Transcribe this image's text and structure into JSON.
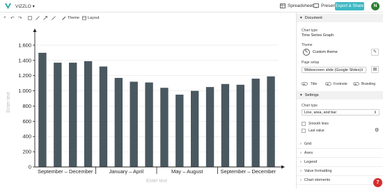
{
  "app": {
    "name": "VIZZLO",
    "spreadsheet_label": "Spreadsheet",
    "present_label": "Present",
    "export_label": "Export & Share",
    "avatar_initial": "N",
    "fab_count": "7"
  },
  "toolbar": {
    "theme_label": "Theme",
    "layout_label": "Layout"
  },
  "sidebar": {
    "document_title": "Document",
    "chart_type_label": "Chart type",
    "chart_type_value": "Time Series Graph",
    "theme_label": "Theme",
    "theme_value": "Custom theme",
    "page_setup_label": "Page setup",
    "page_setup_value": "Widescreen slide (Google Slides)",
    "toggles": [
      "Title",
      "Footnote",
      "Branding"
    ],
    "settings_title": "Settings",
    "settings_chart_type_label": "Chart type",
    "settings_chart_type_value": "Line, area, and bar",
    "smooth_lines_label": "Smooth lines",
    "last_value_label": "Last value",
    "sections": [
      "Grid",
      "Axes",
      "Legend",
      "Value formatting",
      "Chart elements"
    ]
  },
  "chart_data": {
    "type": "bar",
    "series": [
      {
        "values": [
          1500,
          1370,
          1370,
          1390,
          1320,
          1170,
          1120,
          1110,
          1040,
          950,
          1000,
          1050,
          1090,
          1080,
          1160,
          1190
        ]
      }
    ],
    "period_labels": [
      "September – December",
      "January – April",
      "May – August",
      "September – December"
    ],
    "period_sizes": [
      4,
      4,
      4,
      4
    ],
    "y_ticks": [
      "0",
      "200",
      "400",
      "600",
      "800",
      "1.000",
      "1.200",
      "1.400",
      "1.600"
    ],
    "ylim": [
      0,
      1700
    ],
    "ylabel": "Enter text",
    "xlabel": "Enter text",
    "bar_color": "#4a5860",
    "grid": true
  }
}
